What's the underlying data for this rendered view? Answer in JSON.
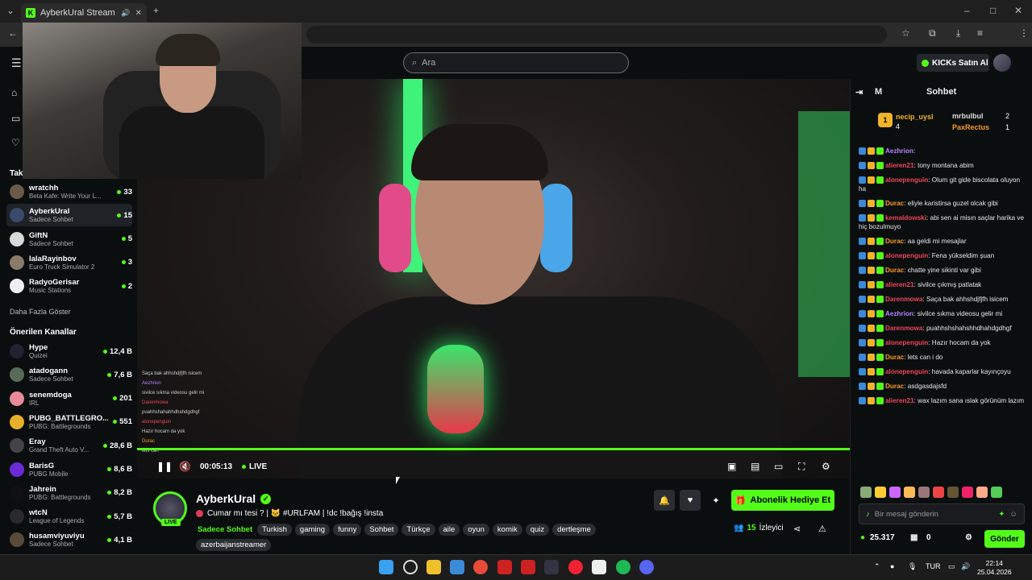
{
  "browser": {
    "tab_title": "AyberkUral Stream - Watch",
    "favicon": "K",
    "new_tab_icon": "+",
    "window_controls": [
      "–",
      "□",
      "✕"
    ]
  },
  "topbar": {
    "search_placeholder": "Ara",
    "kicks_button": "KICKs Satın Al"
  },
  "sidebar": {
    "followed_label": "Tak",
    "followed": [
      {
        "name": "wratchh",
        "sub": "Beta Kafe: Write Your L...",
        "count": "33",
        "color": "#6a5a4a"
      },
      {
        "name": "AyberkUral",
        "sub": "Sadece Sohbet",
        "count": "15",
        "color": "#3a4a6a",
        "active": true
      },
      {
        "name": "GiftN",
        "sub": "Sadece Sohbet",
        "count": "5",
        "color": "#d8d8d8"
      },
      {
        "name": "lalaRayinbov",
        "sub": "Euro Truck Simulator 2",
        "count": "3",
        "color": "#8a7a6a"
      },
      {
        "name": "RadyoGerisar",
        "sub": "Music Stations",
        "count": "2",
        "color": "#eeeeee"
      }
    ],
    "show_more": "Daha Fazla Göster",
    "recommended_label": "Önerilen Kanallar",
    "recommended": [
      {
        "name": "Hype",
        "sub": "Quizei",
        "count": "12,4 B",
        "color": "#222233"
      },
      {
        "name": "atadogann",
        "sub": "Sadece Sohbet",
        "count": "7,6 B",
        "color": "#5a6a5a"
      },
      {
        "name": "senemdoga",
        "sub": "IRL",
        "count": "201",
        "color": "#e88a9a"
      },
      {
        "name": "PUBG_BATTLEGRO...",
        "sub": "PUBG: Battlegrounds",
        "count": "551",
        "color": "#e8b02a"
      },
      {
        "name": "Eray",
        "sub": "Grand Theft Auto V...",
        "count": "28,6 B",
        "color": "#444"
      },
      {
        "name": "BarisG",
        "sub": "PUBG Mobile",
        "count": "8,6 B",
        "color": "#6a2ad8"
      },
      {
        "name": "Jahrein",
        "sub": "PUBG: Battlegrounds",
        "count": "8,2 B",
        "color": "#111"
      },
      {
        "name": "wtcN",
        "sub": "League of Legends",
        "count": "5,7 B",
        "color": "#2a2a2a"
      },
      {
        "name": "husamviyuviyu",
        "sub": "Sadece Sohbet",
        "count": "4,1 B",
        "color": "#5a4a3a"
      }
    ]
  },
  "player": {
    "time": "00:05:13",
    "live_label": "LIVE",
    "overlay_chat": [
      "Saça bak ahhshdjfjfh isicem",
      "Aezhrion",
      "sivilce sıkma videosu gelir mi",
      "Darenmowa",
      "puahhshahahhdhahdgdhgf",
      "alonepenguin",
      "Hazır hocam da yok",
      "Durac",
      "lets can"
    ]
  },
  "stream": {
    "streamer": "AyberkUral",
    "live_badge": "LIVE",
    "title": "Cumar mı tesi ? | 🐱 #URLFAM | !dc !bağış !insta",
    "category": "Sadece Sohbet",
    "tags": [
      "Turkish",
      "gaming",
      "funny",
      "Sohbet",
      "Türkçe",
      "aile",
      "oyun",
      "komik",
      "quiz",
      "dertleşme",
      "azerbaijanstreamer"
    ],
    "subscribe_button": "Abonelik Hediye Et",
    "viewers_count": "15",
    "viewers_label": "İzleyici"
  },
  "chat": {
    "mode_label": "M",
    "header": "Sohbet",
    "leaderboard": {
      "first_user": "necip_uysl",
      "first_count": "4",
      "second_user": "mrbulbul",
      "second_count": "2",
      "third_user": "PaxRectus",
      "third_count": "1"
    },
    "messages": [
      {
        "user": "Aezhrion",
        "cls": "u-purple",
        "text": ""
      },
      {
        "user": "alieren21",
        "cls": "u-red",
        "text": "tony montana abim"
      },
      {
        "user": "alonepenguin",
        "cls": "u-red",
        "text": "Olum git gide biscolata oluyon ha"
      },
      {
        "user": "Durac",
        "cls": "u-orange",
        "text": "eliyle karistirsa guzel olcak gibi"
      },
      {
        "user": "kemaldowski",
        "cls": "u-red",
        "text": "abi sen ai misın saçlar harika ve hiç bozulmuyo"
      },
      {
        "user": "Durac",
        "cls": "u-orange",
        "text": "aa geldi mi mesajlar"
      },
      {
        "user": "alonepenguin",
        "cls": "u-red",
        "text": "Fena yükseldim şuan"
      },
      {
        "user": "Durac",
        "cls": "u-orange",
        "text": "chatte yine sikinti var gibi"
      },
      {
        "user": "alieren21",
        "cls": "u-red",
        "text": "sivilce çıkmış patlatak"
      },
      {
        "user": "Darenmowa",
        "cls": "u-red",
        "text": "Saça bak ahhshdjfjfh isicem"
      },
      {
        "user": "Aezhrion",
        "cls": "u-purple",
        "text": "sivilce sıkma videosu gelir mi"
      },
      {
        "user": "Darenmowa",
        "cls": "u-red",
        "text": "puahhshshahshhdhahdgdhgf"
      },
      {
        "user": "alonepenguin",
        "cls": "u-red",
        "text": "Hazır hocam da yok"
      },
      {
        "user": "Durac",
        "cls": "u-orange",
        "text": "lets can i do"
      },
      {
        "user": "alonepenguin",
        "cls": "u-red",
        "text": "havada kaparlar kayınçoyu"
      },
      {
        "user": "Durac",
        "cls": "u-orange",
        "text": "asdgasdajsfd"
      },
      {
        "user": "alieren21",
        "cls": "u-red",
        "text": "wax lazım sana ıslak görünüm lazım"
      }
    ],
    "input_placeholder": "Bir mesaj gönderin",
    "balance": "25.317",
    "chest_count": "0",
    "send_button": "Gönder"
  },
  "taskbar": {
    "language": "TUR",
    "time": "22:14",
    "date": "25.04.2026"
  },
  "colors": {
    "accent": "#53fc18",
    "background": "#0b0e0f"
  }
}
